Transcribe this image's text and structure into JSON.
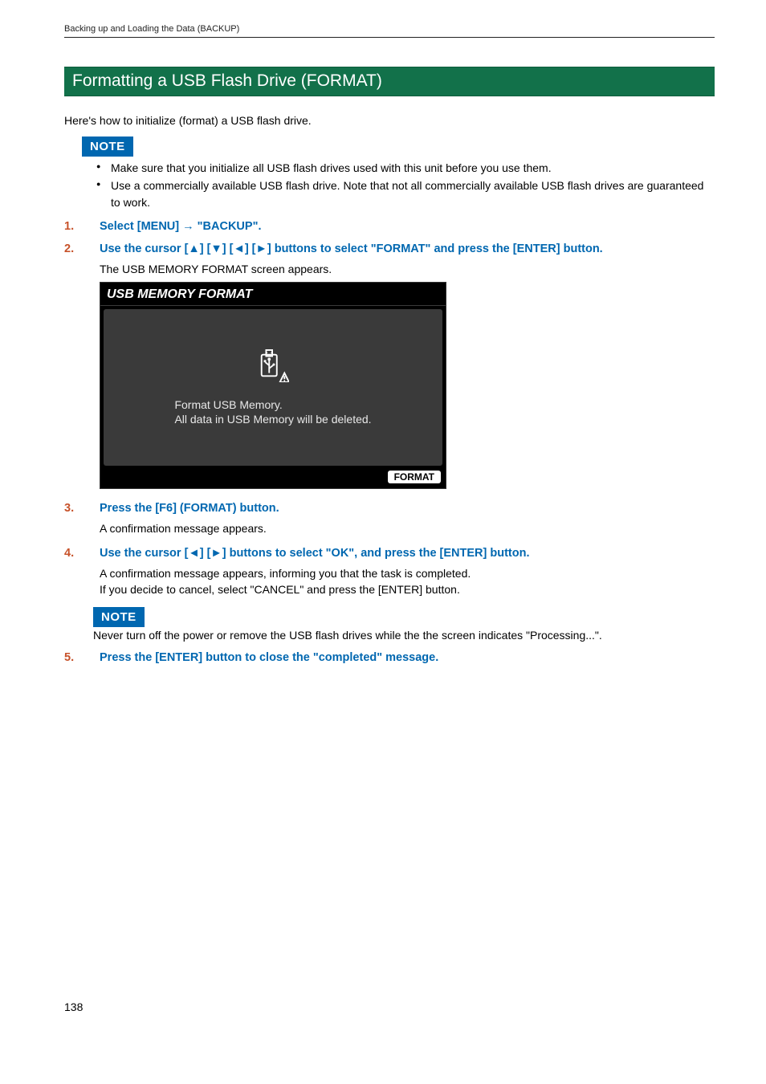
{
  "header": "Backing up and Loading the Data (BACKUP)",
  "section_title": "Formatting a USB Flash Drive (FORMAT)",
  "intro": "Here's how to initialize (format) a USB flash drive.",
  "note_label": "NOTE",
  "note_bullets": [
    "Make sure that you initialize all USB flash drives used with this unit before you use them.",
    "Use a commercially available USB flash drive. Note that not all commercially available USB flash drives are guaranteed to work."
  ],
  "steps": {
    "s1": {
      "num": "1.",
      "txt_pre": "Select [MENU] ",
      "arrow": "→",
      "txt_post": " \"BACKUP\"."
    },
    "s2": {
      "num": "2.",
      "txt": "Use the cursor [▲] [▼] [◄] [►] buttons to select \"FORMAT\" and press the [ENTER] button.",
      "sub": "The USB MEMORY FORMAT screen appears."
    },
    "s3": {
      "num": "3.",
      "txt": "Press the [F6] (FORMAT) button.",
      "sub": "A confirmation message appears."
    },
    "s4": {
      "num": "4.",
      "txt": "Use the cursor [◄] [►] buttons to select \"OK\", and press the [ENTER] button.",
      "sub1": "A confirmation message appears, informing you that the task is completed.",
      "sub2": "If you decide to cancel, select \"CANCEL\" and press the [ENTER] button."
    },
    "s5": {
      "num": "5.",
      "txt": "Press the [ENTER] button to close the \"completed\" message."
    }
  },
  "note2_text": "Never turn off the power or remove the USB flash drives while the the screen indicates \"Processing...\".",
  "screen": {
    "title": "USB MEMORY FORMAT",
    "line1": "Format USB Memory.",
    "line2": "All data in USB Memory will be deleted.",
    "button": "FORMAT"
  },
  "page_number": "138"
}
